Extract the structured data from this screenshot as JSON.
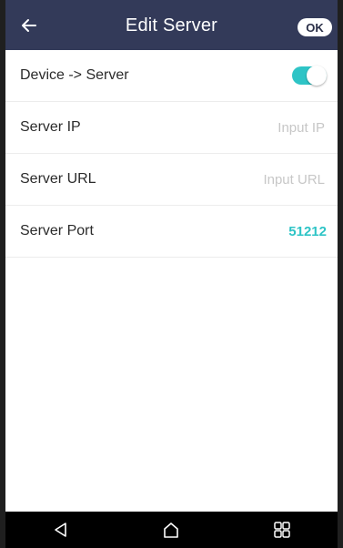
{
  "header": {
    "title": "Edit Server",
    "back_icon": "arrow-left-icon",
    "ok_label": "OK",
    "bg_color": "#333a59"
  },
  "rows": {
    "device_to_server": {
      "label": "Device -> Server",
      "enabled": true
    },
    "server_ip": {
      "label": "Server IP",
      "value": "",
      "placeholder": "Input IP"
    },
    "server_url": {
      "label": "Server URL",
      "value": "",
      "placeholder": "Input URL"
    },
    "server_port": {
      "label": "Server Port",
      "value": "51212"
    }
  },
  "colors": {
    "accent": "#2ec4c6",
    "navbar": "#000000"
  },
  "navbar": {
    "icons": [
      "back-triangle-icon",
      "home-icon",
      "recent-apps-icon"
    ]
  }
}
